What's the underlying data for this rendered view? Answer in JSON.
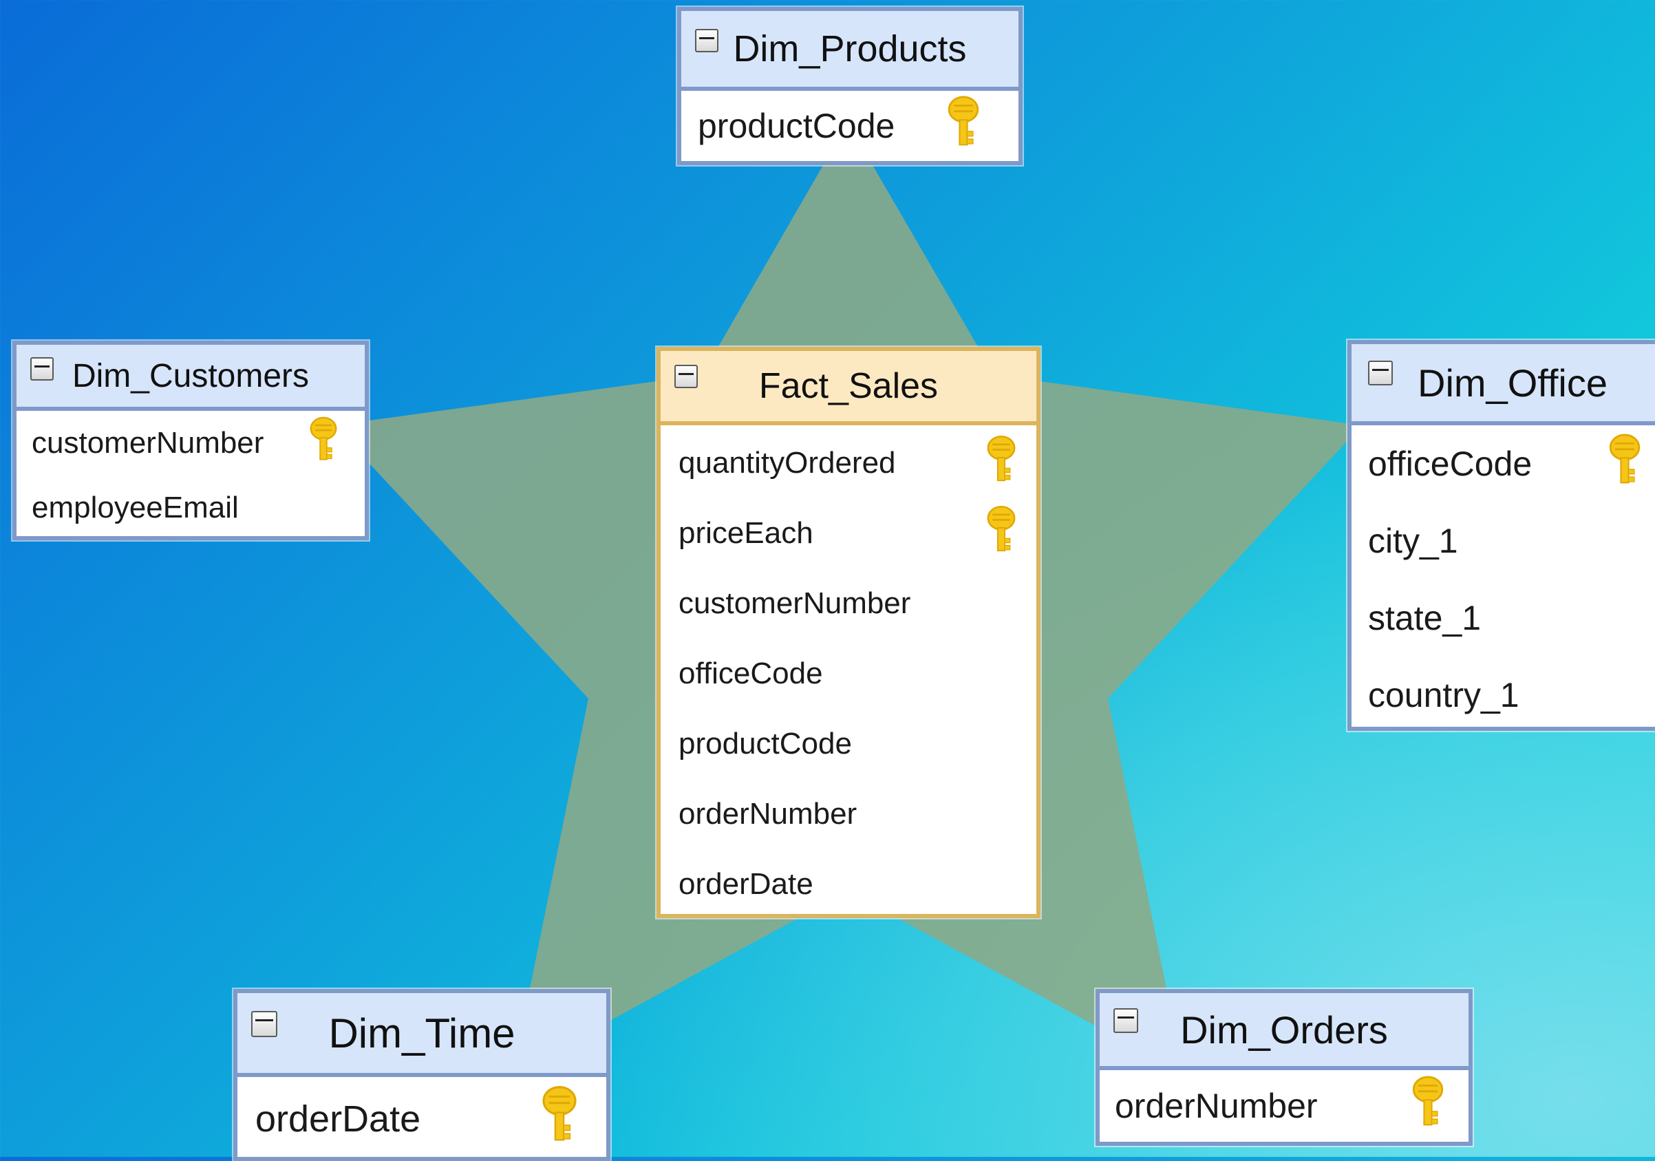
{
  "diagram": {
    "type": "star-schema",
    "colors": {
      "dimension_border": "#7f99c9",
      "dimension_header": "#d6e5fa",
      "fact_border": "#dcb45e",
      "fact_header": "#fde9c1",
      "star_fill": "#8caa88",
      "key_icon": "#f5c518"
    },
    "tables": {
      "products": {
        "name": "Dim_Products",
        "kind": "dimension",
        "columns": [
          {
            "name": "productCode",
            "key": true
          }
        ]
      },
      "customers": {
        "name": "Dim_Customers",
        "kind": "dimension",
        "columns": [
          {
            "name": "customerNumber",
            "key": true
          },
          {
            "name": "employeeEmail",
            "key": false
          }
        ]
      },
      "fact": {
        "name": "Fact_Sales",
        "kind": "fact",
        "columns": [
          {
            "name": "quantityOrdered",
            "key": true
          },
          {
            "name": "priceEach",
            "key": true
          },
          {
            "name": "customerNumber",
            "key": false
          },
          {
            "name": "officeCode",
            "key": false
          },
          {
            "name": "productCode",
            "key": false
          },
          {
            "name": "orderNumber",
            "key": false
          },
          {
            "name": "orderDate",
            "key": false
          }
        ]
      },
      "office": {
        "name": "Dim_Office",
        "kind": "dimension",
        "columns": [
          {
            "name": "officeCode",
            "key": true
          },
          {
            "name": "city_1",
            "key": false
          },
          {
            "name": "state_1",
            "key": false
          },
          {
            "name": "country_1",
            "key": false
          }
        ]
      },
      "time": {
        "name": "Dim_Time",
        "kind": "dimension",
        "columns": [
          {
            "name": "orderDate",
            "key": true
          }
        ]
      },
      "orders": {
        "name": "Dim_Orders",
        "kind": "dimension",
        "columns": [
          {
            "name": "orderNumber",
            "key": true
          }
        ]
      }
    },
    "icons": {
      "key": "key-icon",
      "collapse": "collapse-icon"
    }
  }
}
